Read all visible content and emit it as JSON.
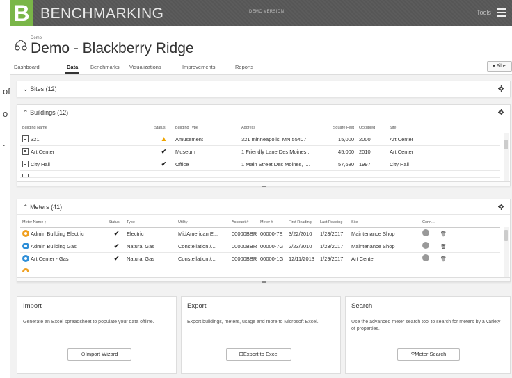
{
  "left_fragment": [
    "of",
    "o",
    "."
  ],
  "topbar": {
    "logo_char": "B",
    "brand": "BENCHMARKING",
    "demo_version": "DEMO VERSION",
    "tools_label": "Tools"
  },
  "header": {
    "org": "Demo",
    "title": "Demo - Blackberry Ridge"
  },
  "tabs": [
    "Dashboard",
    "Data",
    "Benchmarks",
    "Visualizations",
    "Improvements",
    "Reports"
  ],
  "active_tab": "Data",
  "filter_label": "Filter",
  "sites": {
    "title": "Sites (12)"
  },
  "buildings": {
    "title": "Buildings (12)",
    "columns": [
      "Building Name",
      "Status",
      "Building Type",
      "Address",
      "Square Feet",
      "Occupied",
      "Site"
    ],
    "rows": [
      {
        "name": "321",
        "status": "warning",
        "type": "Amusement",
        "address": "321 minneapolis, MN 55407",
        "sqft": "15,000",
        "occupied": "2000",
        "site": "Art Center"
      },
      {
        "name": "Art Center",
        "status": "ok",
        "type": "Museum",
        "address": "1 Friendly Lane Des Moines...",
        "sqft": "45,000",
        "occupied": "2010",
        "site": "Art Center"
      },
      {
        "name": "City Hall",
        "status": "ok",
        "type": "Office",
        "address": "1 Main Street Des Moines, I...",
        "sqft": "57,680",
        "occupied": "1997",
        "site": "City Hall"
      }
    ]
  },
  "meters": {
    "title": "Meters (41)",
    "columns": [
      "Meter Name",
      "Status",
      "Type",
      "Utility",
      "Account #",
      "Meter #",
      "First Reading",
      "Last Reading",
      "Site",
      "Conn..."
    ],
    "rows": [
      {
        "name": "Admin Building Electric",
        "dot": "#f0a020",
        "type": "Electric",
        "utility": "MidAmerican E...",
        "account": "00000BBR",
        "meter": "00000-7E",
        "first": "3/22/2010",
        "last": "1/23/2017",
        "site": "Maintenance Shop"
      },
      {
        "name": "Admin Building Gas",
        "dot": "#2f8fd8",
        "type": "Natural Gas",
        "utility": "Constellation /...",
        "account": "00000BBR",
        "meter": "00000-7G",
        "first": "2/23/2010",
        "last": "1/23/2017",
        "site": "Maintenance Shop"
      },
      {
        "name": "Art Center - Gas",
        "dot": "#2f8fd8",
        "type": "Natural Gas",
        "utility": "Constellation /...",
        "account": "00000BBR",
        "meter": "00000-1G",
        "first": "12/11/2013",
        "last": "1/29/2017",
        "site": "Art Center"
      }
    ]
  },
  "cards": {
    "import": {
      "title": "Import",
      "desc": "Generate an Excel spreadsheet to populate your data offline.",
      "button": "Import Wizard"
    },
    "export": {
      "title": "Export",
      "desc": "Export buildings, meters, usage and more to Microsoft Excel.",
      "button": "Export to Excel"
    },
    "search": {
      "title": "Search",
      "desc": "Use the advanced meter search tool to search for meters by a variety of properties.",
      "button": "Meter Search"
    }
  },
  "colors": {
    "brand_green": "#7ab648",
    "topbar": "#5a5a5a",
    "warning": "#f0a500",
    "meter_blue": "#2f8fd8",
    "meter_orange": "#f0a020"
  }
}
